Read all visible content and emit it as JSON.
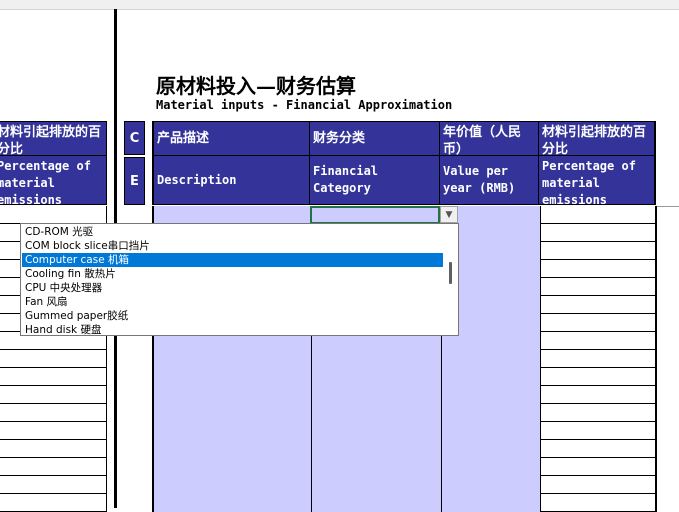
{
  "title": {
    "zh": "原材料投入—财务估算",
    "en": "Material inputs - Financial Approximation"
  },
  "left_column": {
    "header_zh": "材料引起排放的百分比",
    "header_en": "Percentage of material emissions"
  },
  "ce_column": {
    "top": "C",
    "bottom": "E"
  },
  "table": {
    "headers": [
      {
        "zh": "产品描述",
        "en": "Description"
      },
      {
        "zh": "财务分类",
        "en": "Financial Category"
      },
      {
        "zh": "年价值（人民币）",
        "en": "Value per year (RMB)"
      },
      {
        "zh": "材料引起排放的百分比",
        "en": "Percentage of material emissions"
      }
    ]
  },
  "dropdown": {
    "items": [
      "CD-ROM 光驱",
      "COM block slice串口挡片",
      "Computer case 机箱",
      "Cooling fin 散热片",
      "CPU 中央处理器",
      "Fan 风扇",
      "Gummed paper胶纸",
      "Hand disk 硬盘"
    ],
    "selected_index": 2
  },
  "colors": {
    "header_bg": "#333399",
    "header_text": "#ffffff",
    "input_cell": "#ccccff",
    "selection": "#0078d7",
    "active_border": "#217346"
  }
}
